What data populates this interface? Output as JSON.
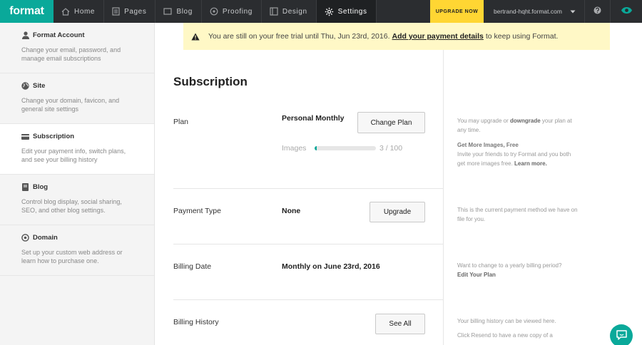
{
  "brand": {
    "logo": "format",
    "accent": "#0aa99a",
    "upgrade_bg": "#ffd633"
  },
  "nav": {
    "items": [
      {
        "label": "Home",
        "icon": "home-icon"
      },
      {
        "label": "Pages",
        "icon": "pages-icon"
      },
      {
        "label": "Blog",
        "icon": "blog-icon"
      },
      {
        "label": "Proofing",
        "icon": "proofing-icon"
      },
      {
        "label": "Design",
        "icon": "design-icon"
      },
      {
        "label": "Settings",
        "icon": "gear-icon",
        "active": true
      }
    ],
    "upgrade_label": "UPGRADE NOW",
    "account": "bertrand-hqht.format.com"
  },
  "sidebar": {
    "items": [
      {
        "title": "Format Account",
        "icon": "user-icon",
        "desc": "Change your email, password, and manage email subscriptions"
      },
      {
        "title": "Site",
        "icon": "globe-icon",
        "desc": "Change your domain, favicon, and general site settings"
      },
      {
        "title": "Subscription",
        "icon": "credit-card-icon",
        "desc": "Edit your payment info, switch plans, and see your billing history",
        "active": true
      },
      {
        "title": "Blog",
        "icon": "blog-book-icon",
        "desc": "Control blog display, social sharing, SEO, and other blog settings."
      },
      {
        "title": "Domain",
        "icon": "domain-target-icon",
        "desc": "Set up your custom web address or learn how to purchase one."
      }
    ]
  },
  "banner": {
    "text_before": "You are still on your free trial until Thu, Jun 23rd, 2016.",
    "link": "Add your payment details",
    "text_after": "to keep using Format."
  },
  "subscription": {
    "title": "Subscription",
    "plan": {
      "label": "Plan",
      "value": "Personal Monthly",
      "button": "Change Plan"
    },
    "images": {
      "label": "Images",
      "used": 3,
      "total": 100,
      "text": "3 / 100"
    },
    "payment": {
      "label": "Payment Type",
      "value": "None",
      "button": "Upgrade"
    },
    "billing_date": {
      "label": "Billing Date",
      "value": "Monthly on June 23rd, 2016"
    },
    "billing_history": {
      "label": "Billing History",
      "button": "See All"
    }
  },
  "hints": {
    "plan": {
      "pre": "You may upgrade or",
      "link": "downgrade",
      "post": "your plan at any time."
    },
    "images": {
      "title": "Get More Images, Free",
      "text": "Invite your friends to try Format and you both get more images free.",
      "link": "Learn more."
    },
    "payment": "This is the current payment method we have on file for you.",
    "billing_date": {
      "text": "Want to change to a yearly billing period?",
      "link": "Edit Your Plan"
    },
    "billing_history": {
      "text1": "Your billing history can be viewed here.",
      "text2": "Click Resend to have a new copy of a"
    }
  }
}
